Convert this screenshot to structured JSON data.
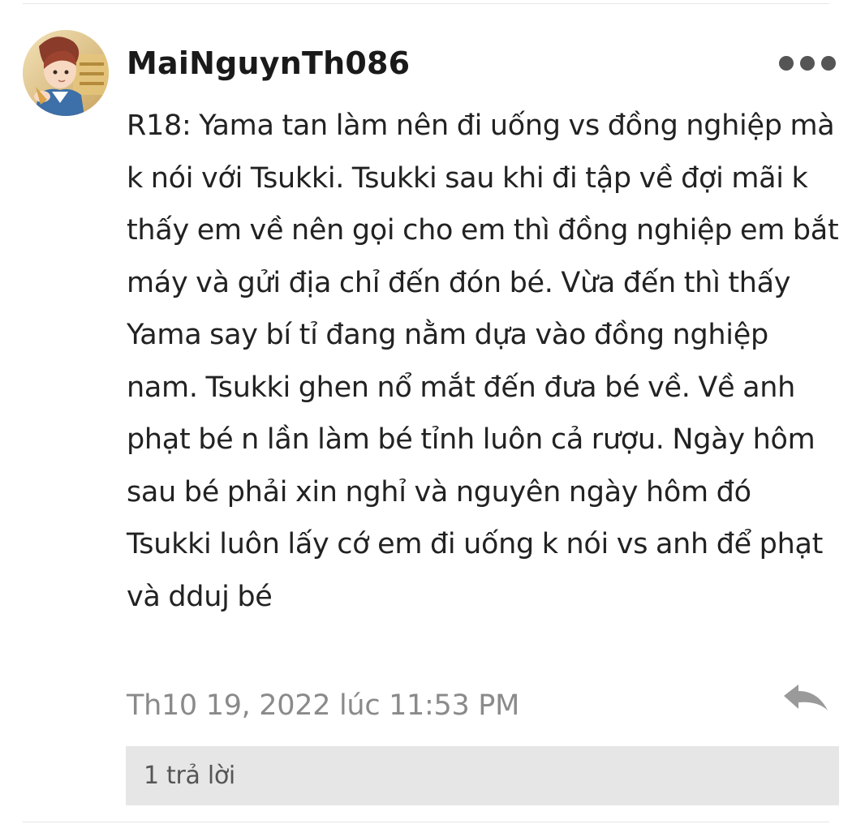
{
  "comment": {
    "username": "MaiNguynTh086",
    "avatar_icon": "anime-avatar-icon",
    "body": "R18: Yama tan làm nên đi uống vs đồng nghiệp mà k nói với Tsukki. Tsukki sau khi đi tập về đợi mãi k thấy em về nên gọi cho em thì đồng nghiệp em bắt máy và gửi địa chỉ đến đón bé. Vừa đến thì thấy Yama say bí tỉ đang nằm dựa vào đồng nghiệp nam. Tsukki ghen nổ mắt đến đưa bé về. Về anh phạt bé n lần làm bé tỉnh luôn cả rượu. Ngày hôm sau bé phải xin nghỉ và nguyên ngày hôm đó Tsukki luôn lấy cớ em đi uống k nói vs anh để phạt và dduj bé",
    "timestamp": "Th10 19, 2022 lúc 11:53 PM",
    "more_icon": "more-options-icon",
    "reply_icon": "reply-arrow-icon",
    "replies_label": "1 trả lời"
  },
  "colors": {
    "text": "#222222",
    "muted": "#8a8a8a",
    "replies_background": "#e6e6e6",
    "icon": "#555555"
  }
}
